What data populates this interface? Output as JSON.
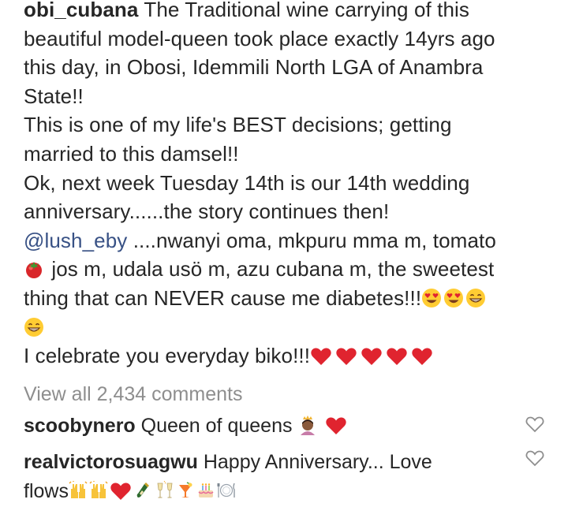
{
  "post": {
    "username": "obi_cubana",
    "caption_lines": [
      "The Traditional wine carrying of this",
      "beautiful model-queen took place exactly 14yrs ago",
      "this day, in Obosi, Idemmili North LGA of Anambra",
      "State!!",
      "This is one of my life's BEST decisions; getting",
      "married to this damsel!!",
      "Ok, next week Tuesday 14th is our 14th wedding",
      "anniversary......the story continues then!"
    ],
    "mention": "@lush_eby",
    "mention_text": " ....nwanyi oma, mkpuru mma m, tomato",
    "line_tomato": " jos m, udala usö m, azu cubana m, the sweetest",
    "line_diabetes": "thing that can NEVER cause me diabetes!!!",
    "line_celebrate": "I celebrate you everyday biko!!!"
  },
  "view_all_comments": "View all 2,434 comments",
  "comments": [
    {
      "username": "scoobynero",
      "text": " Queen of queens "
    },
    {
      "username": "realvictorosuagwu",
      "text": " Happy Anniversary... Love",
      "text_line2": "flows"
    }
  ],
  "colors": {
    "text": "#262626",
    "muted": "#8e8e8e",
    "mention": "#385185",
    "heart": "#e0242f"
  }
}
